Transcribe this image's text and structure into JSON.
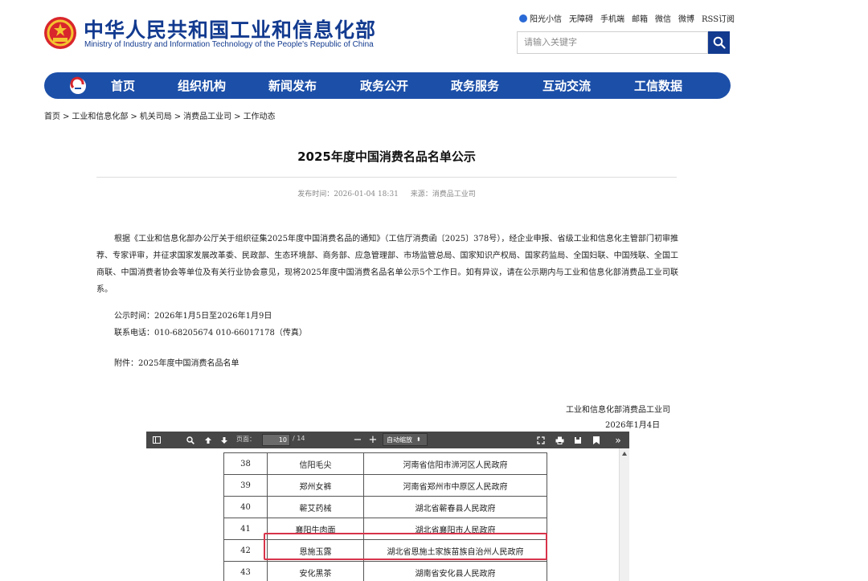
{
  "site": {
    "name_cn": "中华人民共和国工业和信息化部",
    "name_en": "Ministry of Industry and Information Technology of the People's Republic of China"
  },
  "toplinks": [
    "阳光小信",
    "无障碍",
    "手机端",
    "邮箱",
    "微信",
    "微博",
    "RSS订阅"
  ],
  "search": {
    "placeholder": "请输入关键字"
  },
  "nav": [
    "首页",
    "组织机构",
    "新闻发布",
    "政务公开",
    "政务服务",
    "互动交流",
    "工信数据"
  ],
  "breadcrumb": [
    "首页",
    "工业和信息化部",
    "机关司局",
    "消费品工业司",
    "工作动态"
  ],
  "breadcrumb_sep": ">",
  "article": {
    "title": "2025年度中国消费名品名单公示",
    "publish_time": "发布时间：2026-01-04 18:31",
    "source": "来源：消费品工业司",
    "paragraph": "根据《工业和信息化部办公厅关于组织征集2025年度中国消费名品的通知》（工信厅消费函〔2025〕378号），经企业申报、省级工业和信息化主管部门初审推荐、专家评审，并征求国家发展改革委、民政部、生态环境部、商务部、应急管理部、市场监管总局、国家知识产权局、国家药监局、全国妇联、中国残联、全国工商联、中国消费者协会等单位及有关行业协会意见，现将2025年度中国消费名品名单公示5个工作日。如有异议，请在公示期内与工业和信息化部消费品工业司联系。",
    "period": "公示时间：2026年1月5日至2026年1月9日",
    "phone": "联系电话：010-68205674  010-66017178（传真）",
    "attachment": "附件：2025年度中国消费名品名单",
    "signature": "工业和信息化部消费品工业司",
    "sign_date": "2026年1月4日"
  },
  "pdf_viewer": {
    "page_label": "页面：",
    "current_page": "10",
    "total_pages": "/ 14",
    "zoom": "自动缩放",
    "toolbar_icons": [
      "sidebar-toggle-icon",
      "search-icon",
      "arrow-up-icon",
      "arrow-down-icon",
      "zoom-out-icon",
      "zoom-in-icon",
      "fullscreen-icon",
      "print-icon",
      "download-icon",
      "bookmark-icon",
      "more-tools-icon"
    ],
    "rows": [
      {
        "no": "38",
        "name": "信阳毛尖",
        "applicant": "河南省信阳市浉河区人民政府"
      },
      {
        "no": "39",
        "name": "郑州女裤",
        "applicant": "河南省郑州市中原区人民政府"
      },
      {
        "no": "40",
        "name": "蕲艾药械",
        "applicant": "湖北省蕲春县人民政府"
      },
      {
        "no": "41",
        "name": "襄阳牛肉面",
        "applicant": "湖北省襄阳市人民政府"
      },
      {
        "no": "42",
        "name": "恩施玉露",
        "applicant": "湖北省恩施土家族苗族自治州人民政府"
      },
      {
        "no": "43",
        "name": "安化黑茶",
        "applicant": "湖南省安化县人民政府"
      }
    ],
    "highlight_color": "#d8334a"
  },
  "colors": {
    "brand": "#123a8f",
    "nav": "#1c4fa8",
    "toolbar": "#474747"
  }
}
